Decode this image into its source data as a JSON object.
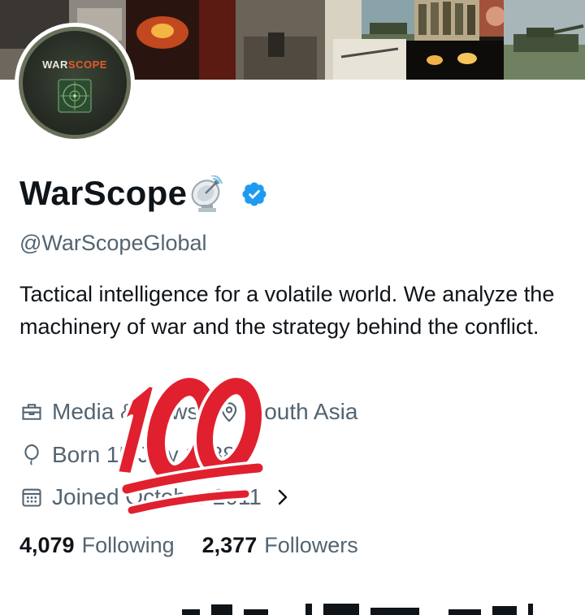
{
  "banner": {
    "description_tiles": [
      "soldiers",
      "ruins",
      "fire",
      "tank-fire",
      "ruins",
      "desert-vehicles",
      "missile",
      "explosions",
      "tank",
      "soldiers-group",
      "portrait",
      "tank"
    ]
  },
  "avatar": {
    "wordmark_part1": "WAR",
    "wordmark_part2": "SCOPE",
    "brand_color": "#e85a26"
  },
  "profile": {
    "display_name": "WarScope",
    "handle": "@WarScopeGlobal",
    "bio": "Tactical intelligence for a volatile world. We analyze the machinery of war and the strategy behind the conflict.",
    "verified_color": "#1d9bf0"
  },
  "meta": {
    "category": "Media & News",
    "location": "South Asia",
    "born": "Born 15 July 1988",
    "joined": "Joined October 2011"
  },
  "counts": {
    "following_count": "4,079",
    "following_label": "Following",
    "followers_count": "2,377",
    "followers_label": "Followers"
  },
  "colors": {
    "text_primary": "#0f1419",
    "text_secondary": "#536471",
    "emoji_red": "#e0202e"
  },
  "icons": {
    "meta": [
      "briefcase-icon",
      "location-pin-icon",
      "balloon-icon",
      "calendar-icon",
      "chevron-right-icon"
    ]
  }
}
